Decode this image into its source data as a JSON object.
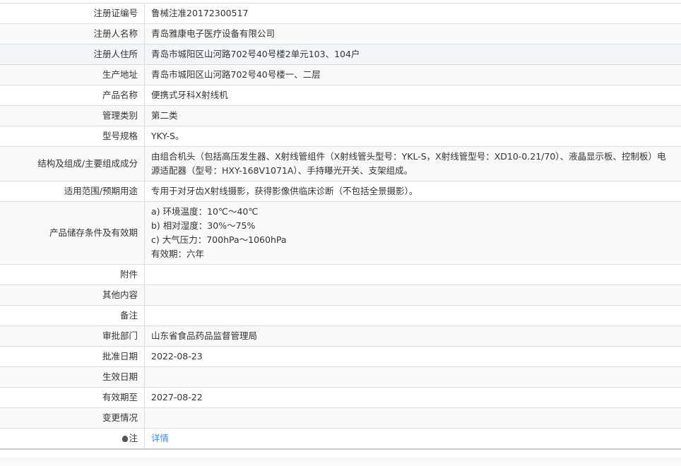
{
  "rows": [
    {
      "label": "注册证编号",
      "value": "鲁械注准20172300517"
    },
    {
      "label": "注册人名称",
      "value": "青岛雅康电子医疗设备有限公司"
    },
    {
      "label": "注册人住所",
      "value": "青岛市城阳区山河路702号40号楼2单元103、104户"
    },
    {
      "label": "生产地址",
      "value": "青岛市城阳区山河路702号40号楼一、二层"
    },
    {
      "label": "产品名称",
      "value": "便携式牙科X射线机"
    },
    {
      "label": "管理类别",
      "value": "第二类"
    },
    {
      "label": "型号规格",
      "value": "YKY-S。"
    },
    {
      "label": "结构及组成/主要组成成分",
      "value": "由组合机头（包括高压发生器、X射线管组件（X射线管头型号：YKL-S，X射线管型号：XD10-0.21/70）、液晶显示板、控制板）电源适配器（型号：HXY-168V1071A）、手持曝光开关、支架组成。"
    },
    {
      "label": "适用范围/预期用途",
      "value": "专用于对牙齿X射线摄影，获得影像供临床诊断（不包括全景摄影）。"
    },
    {
      "label": "产品储存条件及有效期",
      "lines": [
        "a) 环境温度：10℃～40℃",
        "b) 相对湿度：30%～75%",
        "c) 大气压力：700hPa～1060hPa",
        "有效期：六年"
      ]
    },
    {
      "label": "附件",
      "value": ""
    },
    {
      "label": "其他内容",
      "value": ""
    },
    {
      "label": "备注",
      "value": ""
    },
    {
      "label": "审批部门",
      "value": "山东省食品药品监督管理局"
    },
    {
      "label": "批准日期",
      "value": "2022-08-23"
    },
    {
      "label": "生效日期",
      "value": ""
    },
    {
      "label": "有效期至",
      "value": "2027-08-22"
    },
    {
      "label": "变更情况",
      "value": ""
    },
    {
      "label": "注",
      "value": "详情",
      "icon": "lightbulb-icon"
    }
  ]
}
